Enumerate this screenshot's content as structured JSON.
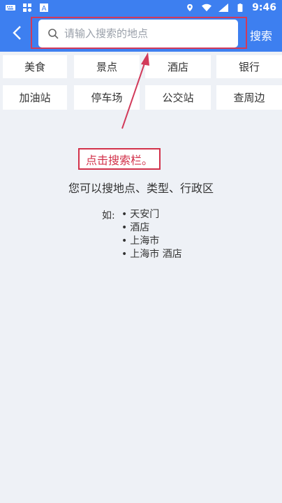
{
  "status_bar": {
    "time": "9:46"
  },
  "header": {
    "search_placeholder": "请输入搜索的地点",
    "search_button": "搜索"
  },
  "categories": [
    {
      "label": "美食"
    },
    {
      "label": "景点"
    },
    {
      "label": "酒店"
    },
    {
      "label": "银行"
    },
    {
      "label": "加油站"
    },
    {
      "label": "停车场"
    },
    {
      "label": "公交站"
    },
    {
      "label": "查周边"
    }
  ],
  "annotation": {
    "callout": "点击搜索栏。"
  },
  "hint": {
    "title": "您可以搜地点、类型、行政区",
    "example_label": "如:",
    "examples": [
      "天安门",
      "酒店",
      "上海市",
      "上海市 酒店"
    ]
  },
  "colors": {
    "header_bg": "#3d7ff0",
    "highlight": "#d23a5a",
    "background": "#eef1f6"
  }
}
